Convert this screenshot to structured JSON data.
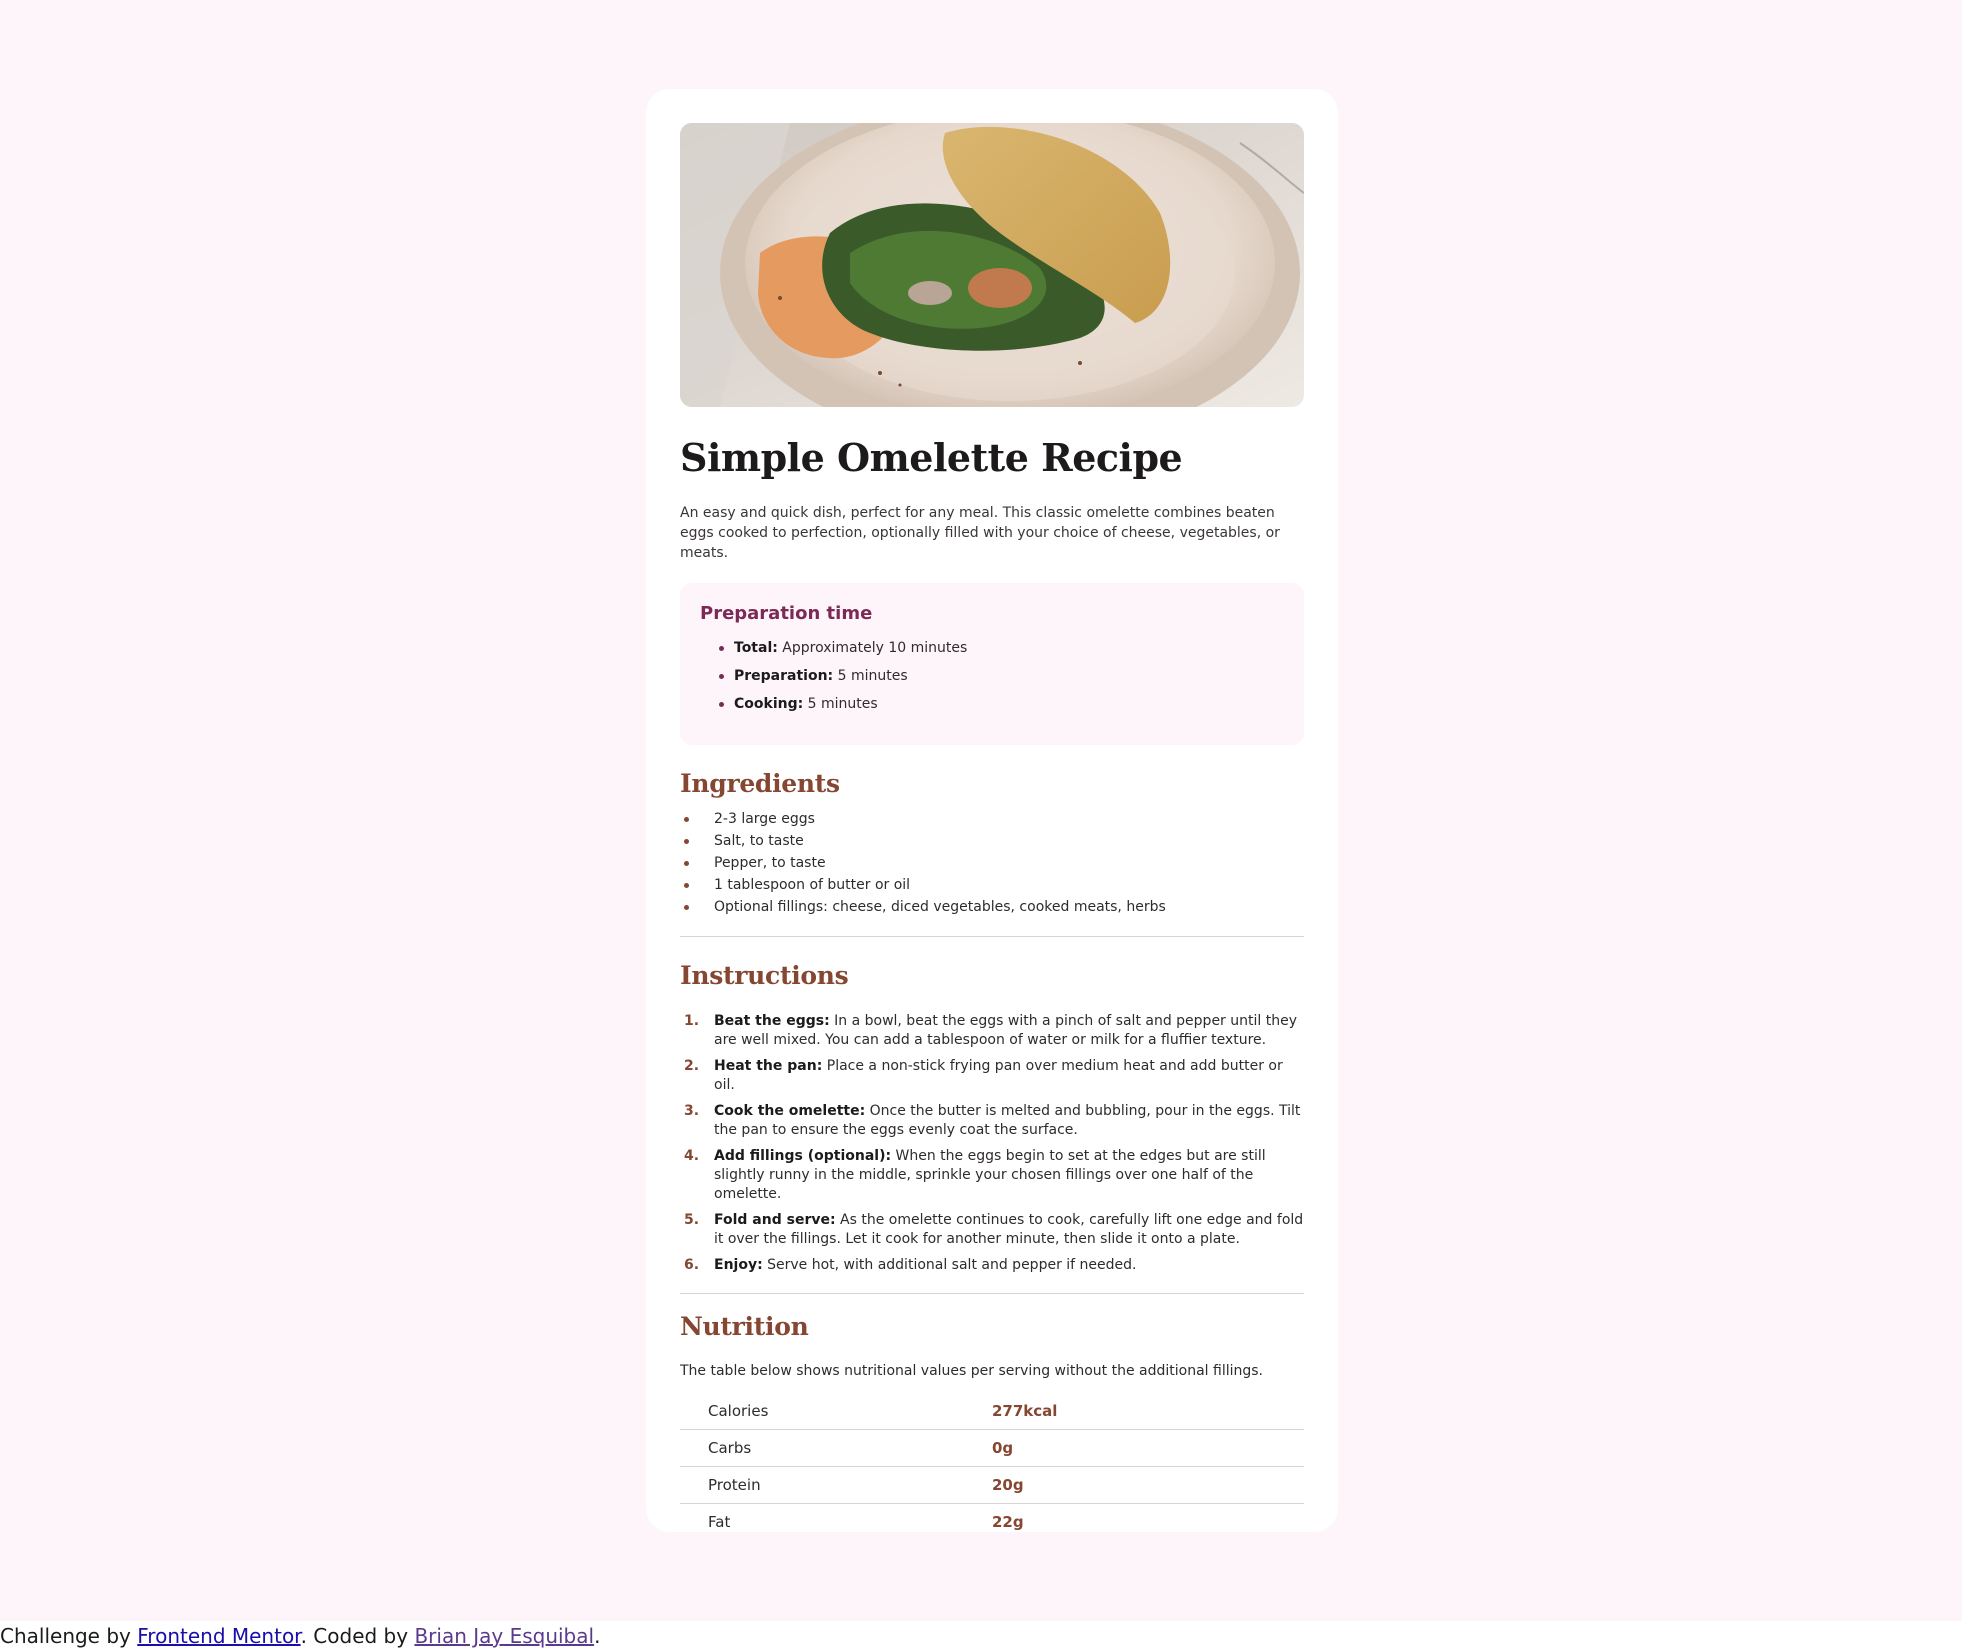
{
  "recipe": {
    "image_alt": "Omelette with spinach on a plate",
    "title": "Simple Omelette Recipe",
    "intro": "An easy and quick dish, perfect for any meal. This classic omelette combines beaten eggs cooked to perfection, optionally filled with your choice of cheese, vegetables, or meats."
  },
  "preparation": {
    "title": "Preparation time",
    "items": [
      {
        "label": "Total:",
        "value": " Approximately 10 minutes"
      },
      {
        "label": "Preparation:",
        "value": " 5 minutes"
      },
      {
        "label": "Cooking:",
        "value": " 5 minutes"
      }
    ]
  },
  "ingredients": {
    "title": "Ingredients",
    "items": [
      "2-3 large eggs",
      "Salt, to taste",
      "Pepper, to taste",
      "1 tablespoon of butter or oil",
      "Optional fillings: cheese, diced vegetables, cooked meats, herbs"
    ]
  },
  "instructions": {
    "title": "Instructions",
    "steps": [
      {
        "num": "1.",
        "label": "Beat the eggs:",
        "text": " In a bowl, beat the eggs with a pinch of salt and pepper until they are well mixed. You can add a tablespoon of water or milk for a fluffier texture."
      },
      {
        "num": "2.",
        "label": "Heat the pan:",
        "text": " Place a non-stick frying pan over medium heat and add butter or oil."
      },
      {
        "num": "3.",
        "label": "Cook the omelette:",
        "text": " Once the butter is melted and bubbling, pour in the eggs. Tilt the pan to ensure the eggs evenly coat the surface."
      },
      {
        "num": "4.",
        "label": "Add fillings (optional):",
        "text": " When the eggs begin to set at the edges but are still slightly runny in the middle, sprinkle your chosen fillings over one half of the omelette."
      },
      {
        "num": "5.",
        "label": "Fold and serve:",
        "text": " As the omelette continues to cook, carefully lift one edge and fold it over the fillings. Let it cook for another minute, then slide it onto a plate."
      },
      {
        "num": "6.",
        "label": "Enjoy:",
        "text": " Serve hot, with additional salt and pepper if needed."
      }
    ]
  },
  "nutrition": {
    "title": "Nutrition",
    "description": "The table below shows nutritional values per serving without the additional fillings.",
    "rows": [
      {
        "label": "Calories",
        "value": "277kcal"
      },
      {
        "label": "Carbs",
        "value": "0g"
      },
      {
        "label": "Protein",
        "value": "20g"
      },
      {
        "label": "Fat",
        "value": "22g"
      }
    ]
  },
  "footer": {
    "prefix": "Challenge by ",
    "link1": "Frontend Mentor",
    "middle": ". Coded by ",
    "link2": "Brian Jay Esquibal",
    "suffix": "."
  },
  "colors": {
    "page_background": "#fef5fa",
    "card_background": "#ffffff",
    "accent_brown": "#854632",
    "accent_rose": "#7b2a55"
  }
}
